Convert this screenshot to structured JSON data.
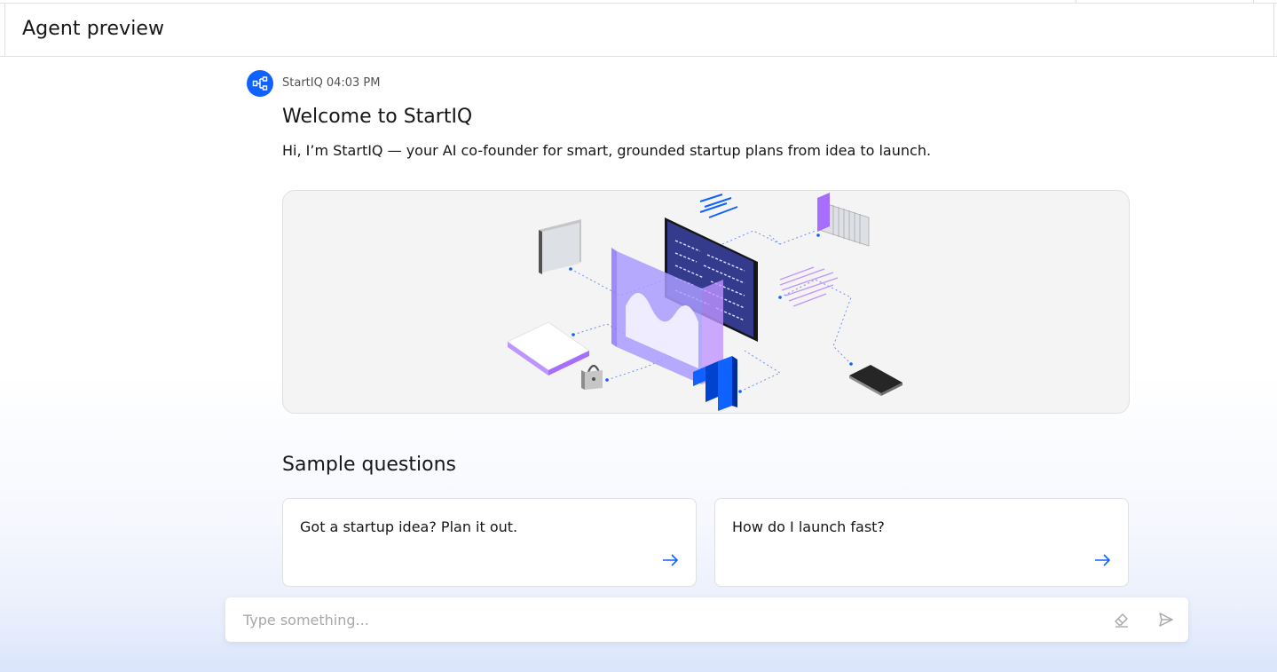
{
  "header": {
    "title": "Agent preview"
  },
  "message": {
    "sender": "StartIQ",
    "time": "04:03 PM",
    "title": "Welcome to StartIQ",
    "text": "Hi, I’m StartIQ — your AI co-founder for smart, grounded startup plans from idea to launch.",
    "avatar_icon": "flow-diagram-icon"
  },
  "hero": {
    "illustration": "isometric-tech-illustration"
  },
  "samples": {
    "title": "Sample questions",
    "cards": [
      {
        "label": "Got a startup idea? Plan it out.",
        "icon": "arrow-right-icon"
      },
      {
        "label": "How do I launch fast?",
        "icon": "arrow-right-icon"
      }
    ]
  },
  "composer": {
    "placeholder": "Type something...",
    "value": "",
    "clear_icon": "eraser-icon",
    "send_icon": "send-icon"
  },
  "colors": {
    "accent": "#0f62fe",
    "purple": "#a56eff",
    "text": "#161616"
  }
}
